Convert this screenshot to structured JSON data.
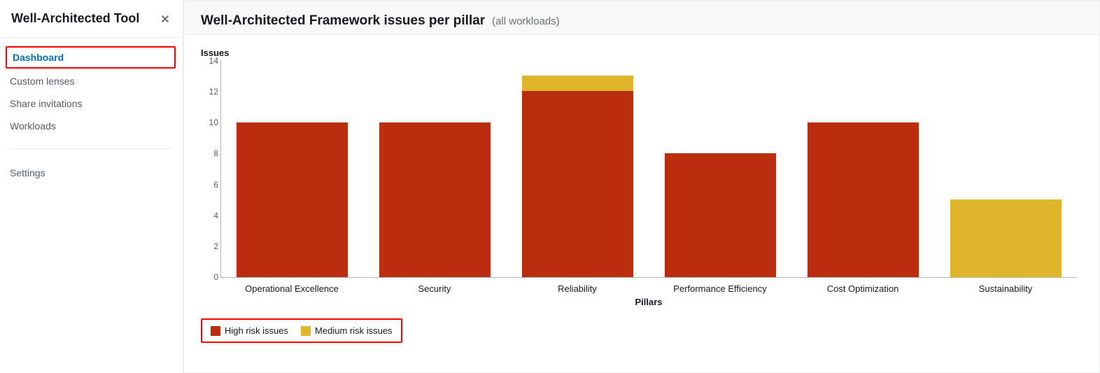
{
  "sidebar": {
    "title": "Well-Architected Tool",
    "items": [
      {
        "label": "Dashboard",
        "active": true
      },
      {
        "label": "Custom lenses",
        "active": false
      },
      {
        "label": "Share invitations",
        "active": false
      },
      {
        "label": "Workloads",
        "active": false
      }
    ],
    "secondary": [
      {
        "label": "Settings"
      }
    ]
  },
  "panel": {
    "title": "Well-Architected Framework issues per pillar",
    "subtitle": "(all workloads)"
  },
  "legend": {
    "high": "High risk issues",
    "medium": "Medium risk issues"
  },
  "colors": {
    "high": "#ba2e0f",
    "medium": "#dfb52c",
    "highlight": "#ff0000",
    "link": "#0073bb"
  },
  "chart_data": {
    "type": "bar",
    "stacked": true,
    "title": "Well-Architected Framework issues per pillar (all workloads)",
    "ylabel": "Issues",
    "xlabel": "Pillars",
    "ylim": [
      0,
      14
    ],
    "yticks": [
      0,
      2,
      4,
      6,
      8,
      10,
      12,
      14
    ],
    "categories": [
      "Operational Excellence",
      "Security",
      "Reliability",
      "Performance Efficiency",
      "Cost Optimization",
      "Sustainability"
    ],
    "series": [
      {
        "name": "High risk issues",
        "color": "#ba2e0f",
        "values": [
          10,
          10,
          12,
          8,
          10,
          0
        ]
      },
      {
        "name": "Medium risk issues",
        "color": "#dfb52c",
        "values": [
          0,
          0,
          1,
          0,
          0,
          5
        ]
      }
    ],
    "legend_position": "bottom-left"
  }
}
